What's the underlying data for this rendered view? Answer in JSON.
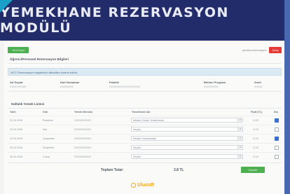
{
  "banner": {
    "title": "YEMEKHANE REZERVASYON MODÜLÜ"
  },
  "toolbar": {
    "new_label": "Yeni Kayıt",
    "user_label": "yemek.rezervasyon",
    "exit_label": "Çıkış"
  },
  "info_section": {
    "title": "Öğrenci/Personel Rezervasyon Bilgileri",
    "alert": "NOT: Rezervasyon bilgilerinizi dikkatlice kontrol ediniz.",
    "fields": [
      {
        "label": "Ad Soyad",
        "value": "XXXXXXXXXX"
      },
      {
        "label": "Kart Numarası",
        "value": "XXXXXXXX"
      },
      {
        "label": "Fakülte",
        "value": "XXXXXXXXXXXXXXXXXXX"
      },
      {
        "label": "Bölüm/ Program",
        "value": "XXXXXXXXX"
      },
      {
        "label": "Sınıfı",
        "value": "XXXXX"
      }
    ]
  },
  "weekly_list": {
    "title": "Haftalık Yemek Listesi",
    "columns": [
      "Tarih",
      "Gün",
      "Yemek Menüsü",
      "Yemekhane Adı",
      "Fiyat (TL)",
      "Seç"
    ],
    "rows": [
      {
        "date": "22.10.2018",
        "day": "Pazartesi",
        "menu": "XXXXXXXXXX",
        "hall": "Merkezi Yemek Yemekhanesi",
        "price": "X,XX",
        "checked": true
      },
      {
        "date": "23.10.2018",
        "day": "Salı",
        "menu": "XXXXXXXXXX",
        "hall": "Seçiniz",
        "price": "X,XX",
        "checked": false
      },
      {
        "date": "24.10.2018",
        "day": "Çarşamba",
        "menu": "XXXXXXXXXX",
        "hall": "Merkezi Yemekhanesi",
        "price": "X,XX",
        "checked": true
      },
      {
        "date": "25.10.2018",
        "day": "Perşembe",
        "menu": "XXXXXXXXXX",
        "hall": "Seçiniz",
        "price": "X,XX",
        "checked": false
      },
      {
        "date": "26.10.2018",
        "day": "Cuma",
        "menu": "XXXXXXXXXX",
        "hall": "Seçiniz",
        "price": "X,XX",
        "checked": false
      }
    ]
  },
  "footer": {
    "total_label": "Toplam Tutar:",
    "total_value": "3.8 TL",
    "save_label": "Kaydet"
  },
  "logo": {
    "text": "Ulusoft"
  },
  "colors": {
    "banner": "#232c6a",
    "accent": "#1aa0c8",
    "green": "#4caf50",
    "red": "#e53935",
    "logo": "#f2a61c"
  }
}
